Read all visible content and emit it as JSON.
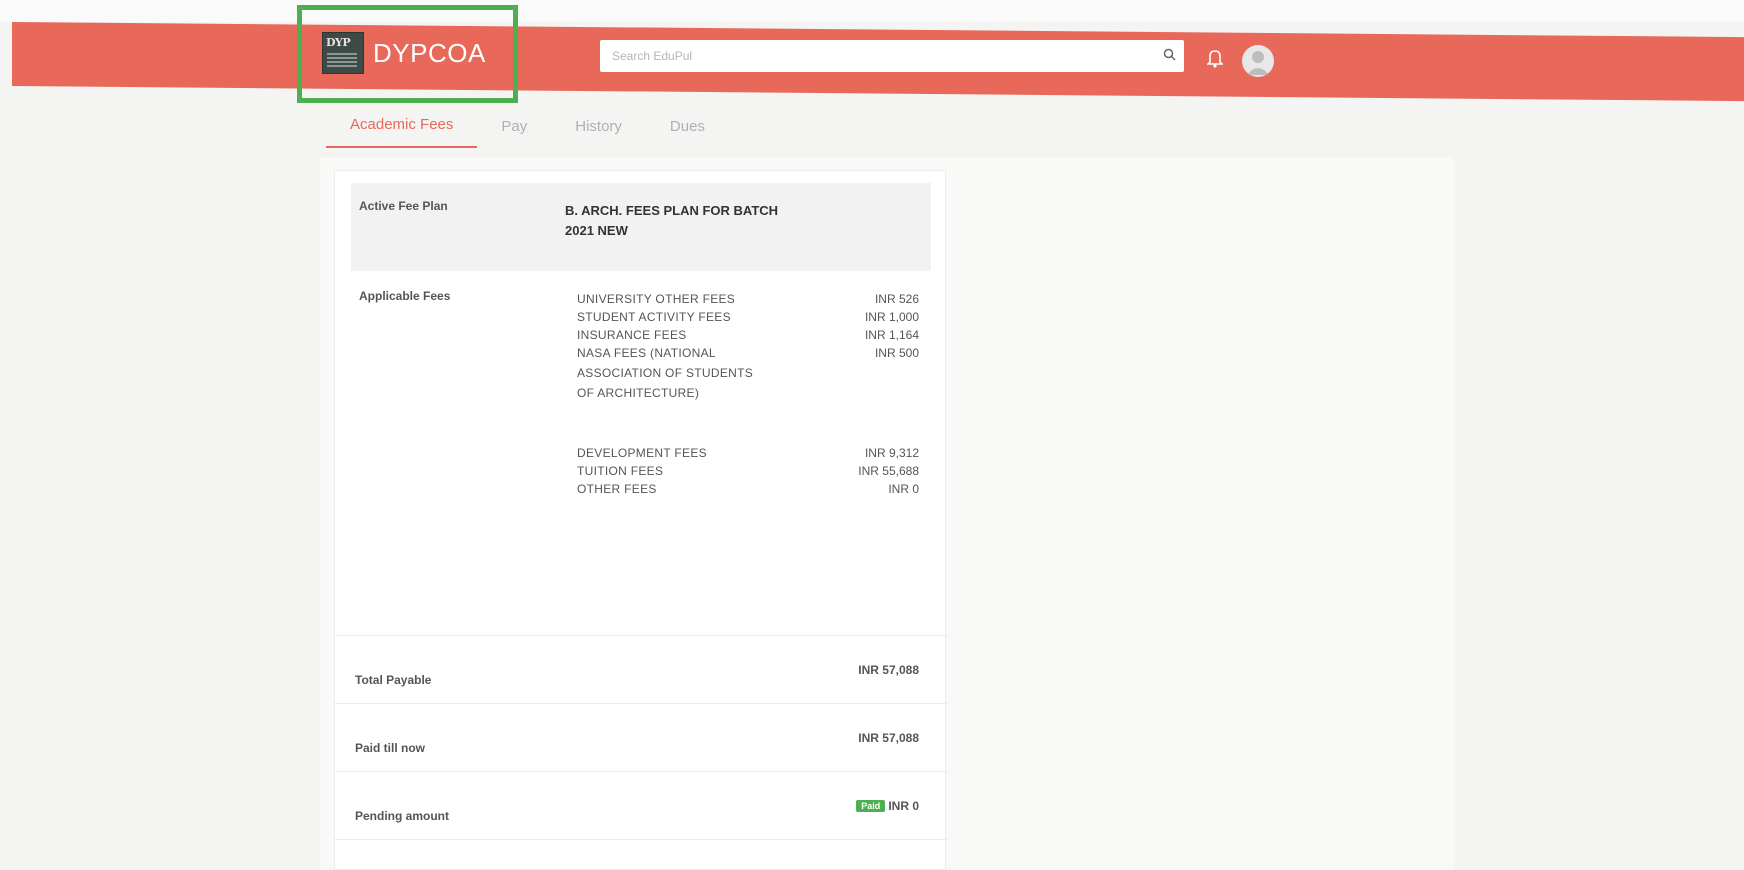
{
  "header": {
    "brand_name": "DYPCOA",
    "logo_text": "DYP",
    "search_placeholder": "Search EduPul",
    "accent_color": "#e8685a"
  },
  "tabs": [
    {
      "label": "Academic Fees",
      "active": true
    },
    {
      "label": "Pay",
      "active": false
    },
    {
      "label": "History",
      "active": false
    },
    {
      "label": "Dues",
      "active": false
    }
  ],
  "fee_plan": {
    "label": "Active Fee Plan",
    "value": "B. ARCH. FEES PLAN FOR BATCH 2021 NEW"
  },
  "applicable_fees": {
    "label": "Applicable Fees",
    "items": [
      {
        "name": "UNIVERSITY OTHER FEES",
        "amount": "INR 526"
      },
      {
        "name": "STUDENT ACTIVITY FEES",
        "amount": "INR 1,000"
      },
      {
        "name": "INSURANCE FEES",
        "amount": "INR 1,164"
      },
      {
        "name": "NASA FEES (NATIONAL ASSOCIATION OF STUDENTS OF ARCHITECTURE)",
        "amount": "INR 500"
      },
      {
        "name": "DEVELOPMENT FEES",
        "amount": "INR 9,312"
      },
      {
        "name": "TUITION FEES",
        "amount": "INR 55,688"
      },
      {
        "name": "OTHER FEES",
        "amount": "INR 0"
      }
    ]
  },
  "summary": {
    "total_payable": {
      "label": "Total Payable",
      "amount": "INR 57,088"
    },
    "paid_till_now": {
      "label": "Paid till now",
      "amount": "INR 57,088"
    },
    "pending_amount": {
      "label": "Pending amount",
      "badge": "Paid",
      "amount": "INR 0"
    }
  }
}
